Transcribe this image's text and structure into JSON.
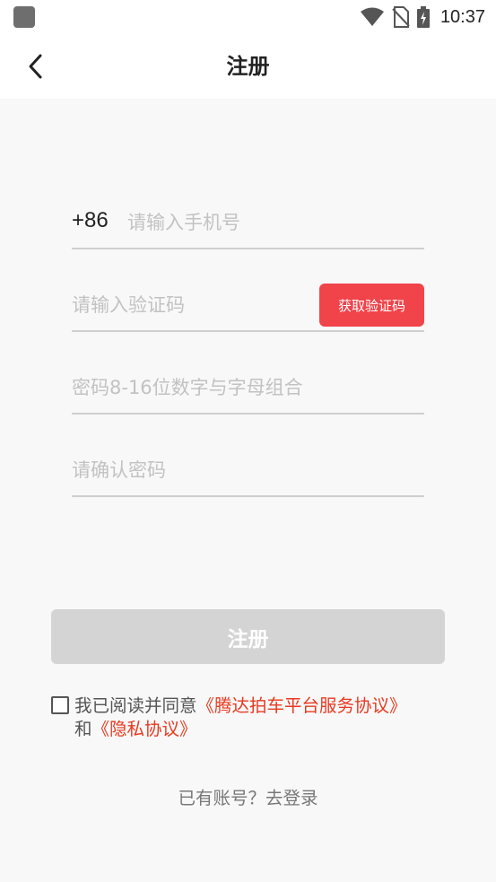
{
  "status_bar": {
    "time": "10:37",
    "icons": [
      "app-notification-icon",
      "wifi-icon",
      "no-sim-icon",
      "battery-charging-icon"
    ]
  },
  "header": {
    "title": "注册",
    "back_icon": "chevron-left-icon"
  },
  "form": {
    "country_code": "+86",
    "phone_placeholder": "请输入手机号",
    "code_placeholder": "请输入验证码",
    "get_code_label": "获取验证码",
    "password_placeholder": "密码8-16位数字与字母组合",
    "confirm_placeholder": "请确认密码",
    "register_label": "注册"
  },
  "agreement": {
    "prefix": "我已阅读并同意",
    "service_link": "《腾达拍车平台服务协议》",
    "connector": "和",
    "privacy_link": "《隐私协议》",
    "checked": false
  },
  "footer": {
    "login_prompt": "已有账号？去登录"
  },
  "colors": {
    "accent": "#f1434a",
    "link": "#e8391f",
    "disabled_button": "#d4d4d4",
    "background": "#f8f8f8"
  }
}
